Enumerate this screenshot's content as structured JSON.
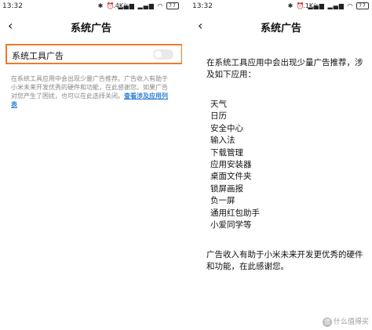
{
  "left": {
    "status": {
      "time": "13:32",
      "rate": "1.4K/s",
      "battery": "77"
    },
    "header": {
      "title": "系统广告"
    },
    "setting": {
      "label": "系统工具广告",
      "enabled": false
    },
    "description": {
      "text": "在系统工具应用中会出现少量广告推荐。广告收入有助于小米未来开发优秀的硬件和功能，在此感谢您。如果广告对您产生了困扰，也可以在此选择关闭。",
      "link": "查看涉及应用列表"
    }
  },
  "right": {
    "status": {
      "time": "13:32",
      "rate": "2.1K/s",
      "battery": "77"
    },
    "header": {
      "title": "系统广告"
    },
    "intro": "在系统工具应用中会出现少量广告推荐，涉及如下应用：",
    "apps": [
      "天气",
      "日历",
      "安全中心",
      "输入法",
      "下载管理",
      "应用安装器",
      "桌面文件夹",
      "锁屏画报",
      "负一屏",
      "通用红包助手",
      "小爱同学等"
    ],
    "outro": "广告收入有助于小米未来开发更优秀的硬件和功能，在此感谢您。"
  },
  "watermark": {
    "text": "什么值得买",
    "icon": "值"
  },
  "colors": {
    "highlight": "#f07a28",
    "link": "#2f7fd8",
    "toggle_off": "#e9e9e9"
  },
  "icons": {
    "back": "chevron-left-icon"
  }
}
